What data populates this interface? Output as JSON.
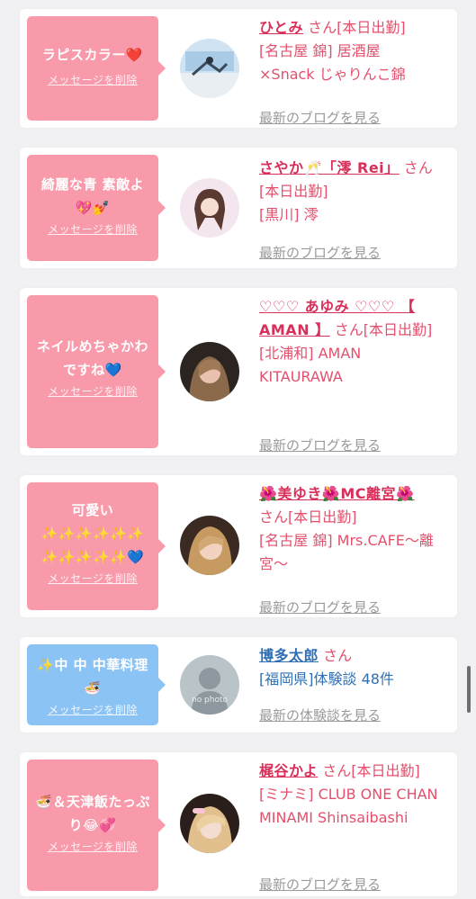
{
  "cards": [
    {
      "message": "ラピスカラー❤️",
      "delete_label": "メッセージを削除",
      "name": "ひとみ",
      "honorific": "さん[本日出勤]",
      "details": [
        "[名古屋 錦] 居酒屋",
        "×Snack じゃりんこ錦"
      ],
      "link": "最新のブログを見る"
    },
    {
      "message": "綺麗な青 素敵よ\n💖💅",
      "delete_label": "メッセージを削除",
      "name": "さやか🥂「澪 Rei」",
      "honorific": "さん[本日出勤]",
      "details": [
        "[黒川] 澪"
      ],
      "link": "最新のブログを見る"
    },
    {
      "message": "ネイルめちゃかわ\nですね💙",
      "delete_label": "メッセージを削除",
      "name": "♡♡♡ あゆみ ♡♡♡ 【 AMAN 】",
      "honorific": "さん[本日出勤]",
      "details": [
        "[北浦和] AMAN KITAURAWA"
      ],
      "link": "最新のブログを見る"
    },
    {
      "message": "可愛い\n✨✨✨✨✨✨\n✨✨✨✨✨💙",
      "delete_label": "メッセージを削除",
      "name": "🌺美ゆき🌺MC離宮🌺",
      "honorific": "さん[本日出勤]",
      "details": [
        "[名古屋 錦] Mrs.CAFE〜離宮〜"
      ],
      "link": "最新のブログを見る"
    },
    {
      "message": "✨中 中 中華料理\n🍜",
      "delete_label": "メッセージを削除",
      "name": "博多太郎",
      "honorific": "さん",
      "details": [
        "[福岡県]体験談 48件"
      ],
      "link": "最新の体験談を見る",
      "avatar_text": "no photo"
    },
    {
      "message": "🍜＆天津飯たっぷ\nり😂💞",
      "delete_label": "メッセージを削除",
      "name": "梶谷かよ",
      "honorific": "さん[本日出勤]",
      "details": [
        "[ミナミ] CLUB ONE CHAN MINAMI Shinsaibashi"
      ],
      "link": "最新のブログを見る"
    }
  ],
  "colors": {
    "pink_bubble": "#f99aab",
    "blue_bubble": "#8cc3f5",
    "name_pink": "#d8305a",
    "name_blue": "#2f6fb4",
    "link_gray": "#9a9a9a"
  }
}
